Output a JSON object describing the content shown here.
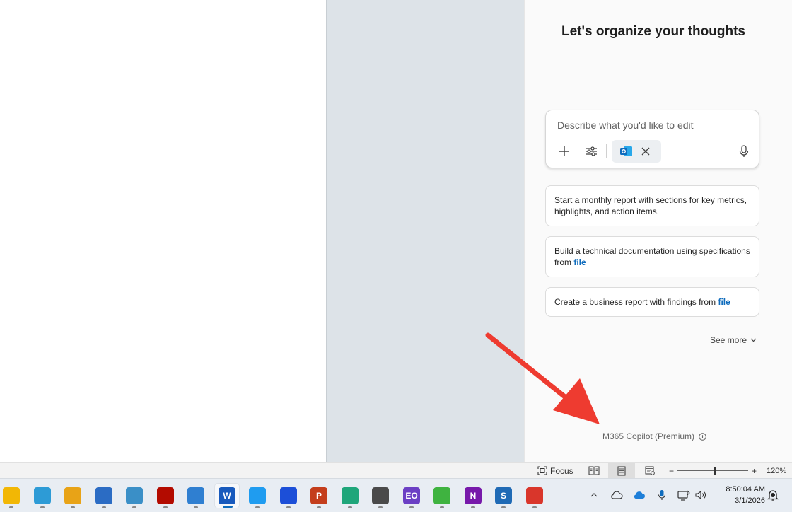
{
  "copilot": {
    "title": "Let's organize your thoughts",
    "prompt_placeholder": "Describe what you'd like to edit",
    "suggestions": [
      {
        "text": "Start a monthly report with sections for key metrics, highlights, and action items.",
        "link": ""
      },
      {
        "text": "Build a technical documentation using specifications from ",
        "link": "file"
      },
      {
        "text": "Create a business report with findings from ",
        "link": "file"
      }
    ],
    "see_more": "See more",
    "model_label": "M365 Copilot (Premium)"
  },
  "status_bar": {
    "focus_label": "Focus",
    "zoom_percent": "120%",
    "zoom_minus": "−",
    "zoom_plus": "+"
  },
  "taskbar": {
    "apps": [
      {
        "icon": "file-explorer-icon",
        "color": "#f2b705",
        "letter": ""
      },
      {
        "icon": "network-app-icon",
        "color": "#2d9bd6",
        "letter": ""
      },
      {
        "icon": "notes-app-icon",
        "color": "#e8a317",
        "letter": ""
      },
      {
        "icon": "remote-desktop-icon",
        "color": "#2b6cc4",
        "letter": ""
      },
      {
        "icon": "notepad-icon",
        "color": "#3a8fc7",
        "letter": ""
      },
      {
        "icon": "acrobat-icon",
        "color": "#b30b00",
        "letter": ""
      },
      {
        "icon": "photos-icon",
        "color": "#2f7fd1",
        "letter": ""
      },
      {
        "icon": "word-icon",
        "color": "#185abd",
        "letter": "W"
      },
      {
        "icon": "vscode-icon",
        "color": "#1f9cf0",
        "letter": ""
      },
      {
        "icon": "arc-icon",
        "color": "#1c4fd8",
        "letter": ""
      },
      {
        "icon": "powerpoint-icon",
        "color": "#c43e1c",
        "letter": "P"
      },
      {
        "icon": "edge-icon",
        "color": "#1fa67a",
        "letter": ""
      },
      {
        "icon": "printer-app-icon",
        "color": "#4a4a4a",
        "letter": ""
      },
      {
        "icon": "reader-app-icon",
        "color": "#6b3fc4",
        "letter": "EO"
      },
      {
        "icon": "camtasia-icon",
        "color": "#3fb340",
        "letter": ""
      },
      {
        "icon": "onenote-icon",
        "color": "#7719aa",
        "letter": "N"
      },
      {
        "icon": "snagit-icon",
        "color": "#1f6ab5",
        "letter": "S"
      },
      {
        "icon": "camtasia-red-icon",
        "color": "#d9362b",
        "letter": ""
      }
    ],
    "clock_time": "8:50:04 AM",
    "clock_date": "3/1/2026"
  },
  "colors": {
    "accent": "#0f6cbd",
    "annotation_arrow": "#ee3b30"
  }
}
